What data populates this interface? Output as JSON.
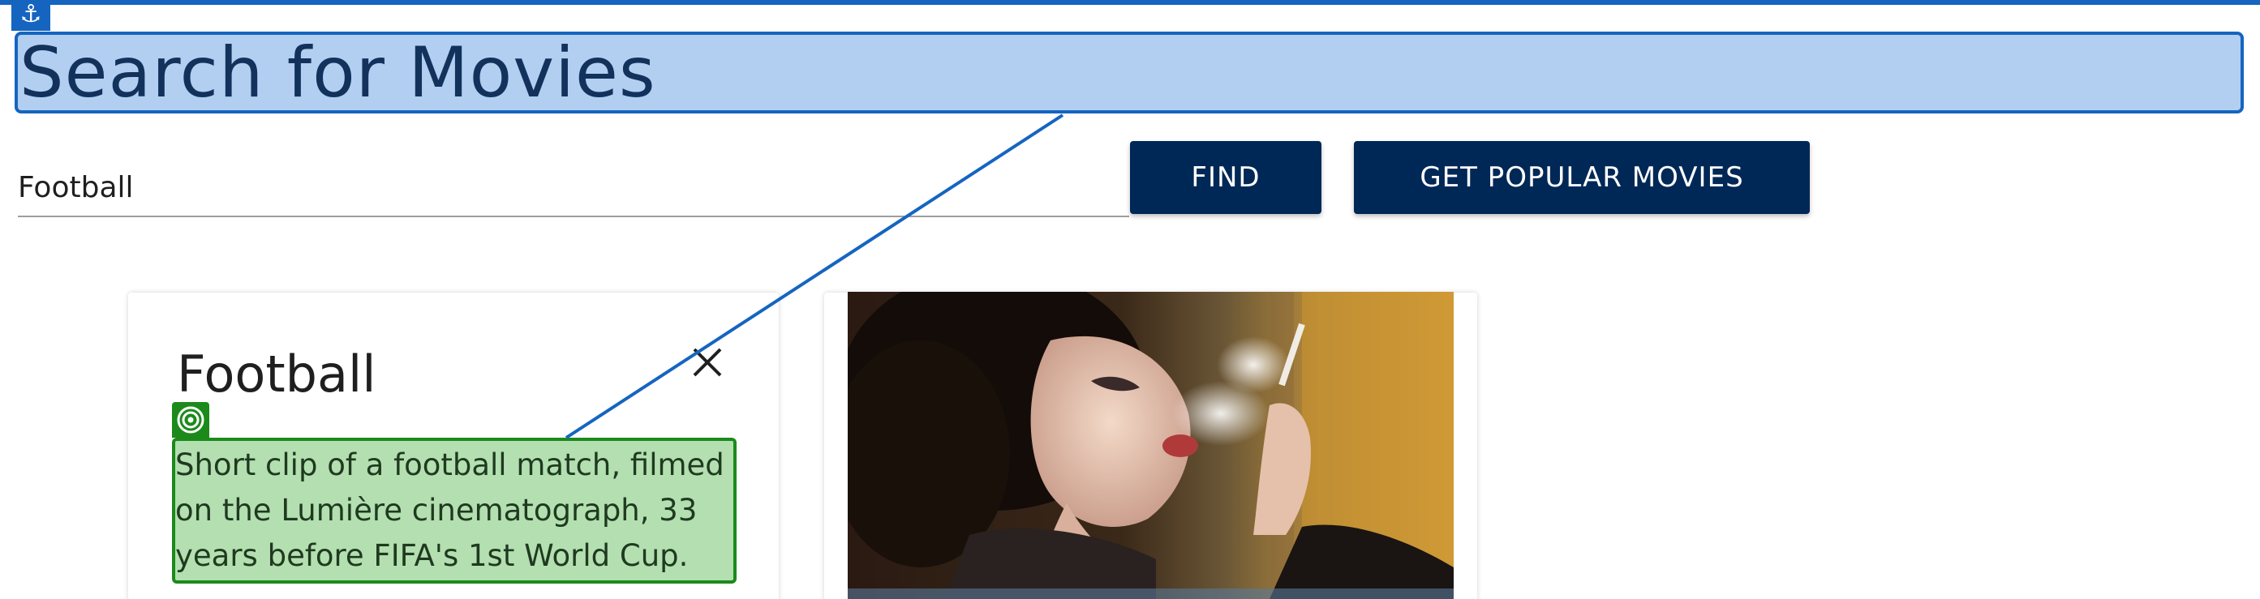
{
  "header": {
    "title": "Search for Movies"
  },
  "search": {
    "value": "Football",
    "placeholder": ""
  },
  "buttons": {
    "find_label": "FIND",
    "popular_label": "GET POPULAR MOVIES"
  },
  "card": {
    "title": "Football",
    "description": "Short clip of a football match, filmed on the Lumière cinematograph, 33 years before FIFA's 1st World Cup."
  },
  "colors": {
    "button_bg": "#002856",
    "title_highlight": "#b2cff2",
    "title_highlight_border": "#1565c0",
    "desc_highlight": "#b3dfb1",
    "desc_highlight_border": "#1b8a1b"
  },
  "icons": {
    "anchor": "anchor-icon",
    "close": "close-icon",
    "target": "target-icon"
  }
}
